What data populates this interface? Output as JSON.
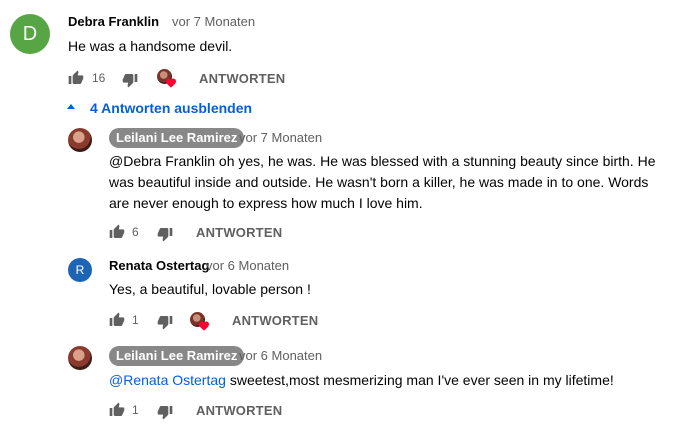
{
  "comment": {
    "avatar_letter": "D",
    "avatar_color": "#57a544",
    "author": "Debra Franklin",
    "time": "vor 7 Monaten",
    "text": "He was a handsome devil.",
    "likes": "16",
    "reply_label": "ANTWORTEN"
  },
  "replies_toggle": {
    "label": "4 Antworten ausblenden"
  },
  "replies": [
    {
      "author": "Leilani Lee Ramirez",
      "time": "vor 7 Monaten",
      "text_lines": [
        "@Debra Franklin oh yes, he was. He was blessed with a stunning beauty since birth. He",
        "was beautiful inside and outside. He wasn't born a killer, he was made in to one. Words",
        "are never enough to express how much I love him."
      ],
      "likes": "6",
      "reply_label": "ANTWORTEN"
    },
    {
      "avatar_letter": "R",
      "avatar_color": "#1e64b4",
      "author": "Renata Ostertag",
      "time": "vor 6 Monaten",
      "text": "Yes, a beautiful, lovable person !",
      "likes": "1",
      "reply_label": "ANTWORTEN"
    },
    {
      "author": "Leilani Lee Ramirez",
      "time": "vor 6 Monaten",
      "mention": "@Renata Ostertag",
      "text": " sweetest,most mesmerizing man I've ever seen in my lifetime!",
      "likes": "1",
      "reply_label": "ANTWORTEN"
    }
  ],
  "colors": {
    "accent_link": "#065fd4",
    "heart": "#ff0033",
    "badge": "#888888"
  }
}
